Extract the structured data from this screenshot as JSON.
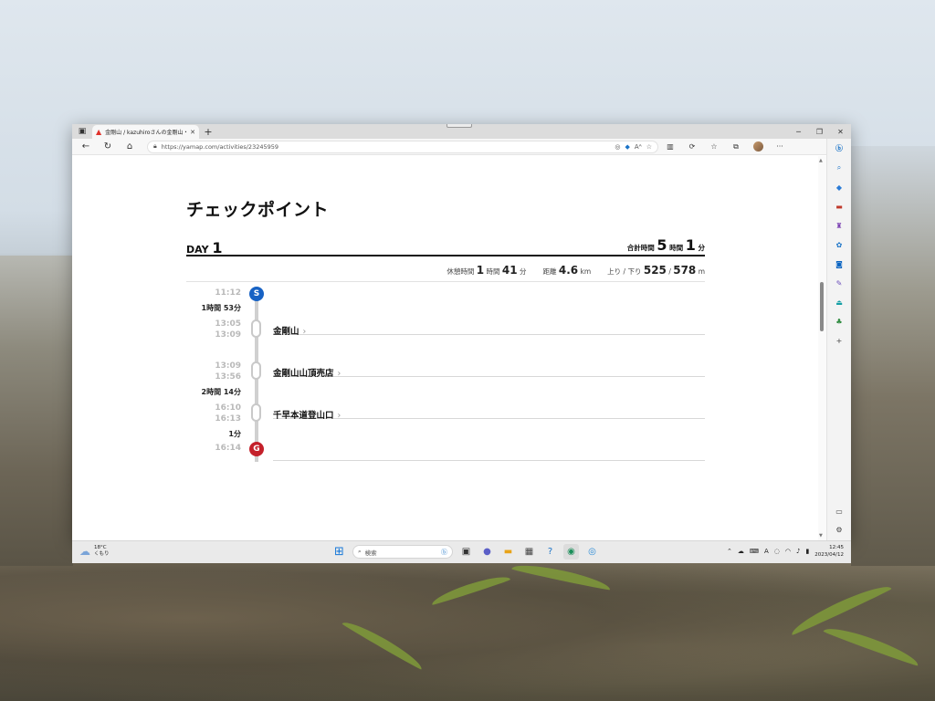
{
  "browser": {
    "tab_title": "金剛山 / kazuhiroさんの金剛山・二",
    "tab_favicon": "yamap-logo-icon",
    "url": "https://yamap.com/activities/23245959"
  },
  "page": {
    "title": "チェックポイント",
    "day_label": "DAY",
    "day_number": "1",
    "total_label": "合計時間",
    "total_hours": "5",
    "total_hours_unit": "時間",
    "total_minutes": "1",
    "total_minutes_unit": "分",
    "stats": {
      "rest_label": "休憩時間",
      "rest_hours": "1",
      "rest_hours_unit": "時間",
      "rest_minutes": "41",
      "rest_minutes_unit": "分",
      "distance_label": "距離",
      "distance_value": "4.6",
      "distance_unit": "km",
      "updown_label": "上り / 下り",
      "up_value": "525",
      "separator": "/",
      "down_value": "578",
      "updown_unit": "m"
    }
  },
  "timeline": {
    "start": {
      "marker": "S",
      "time": "11:12"
    },
    "durations": [
      "1時間 53分",
      "2時間 14分",
      "1分"
    ],
    "checkpoints": [
      {
        "arrive": "13:05",
        "depart": "13:09",
        "name": "金剛山"
      },
      {
        "arrive": "13:09",
        "depart": "13:56",
        "name": "金剛山山頂売店"
      },
      {
        "arrive": "16:10",
        "depart": "16:13",
        "name": "千早本道登山口"
      }
    ],
    "goal": {
      "marker": "G",
      "time": "16:14"
    },
    "chevron": "›"
  },
  "taskbar": {
    "weather_temp": "18°C",
    "weather_desc": "くもり",
    "search_placeholder": "検索",
    "clock_time": "12:45",
    "clock_date": "2023/04/12",
    "ime_indicator": "A"
  }
}
